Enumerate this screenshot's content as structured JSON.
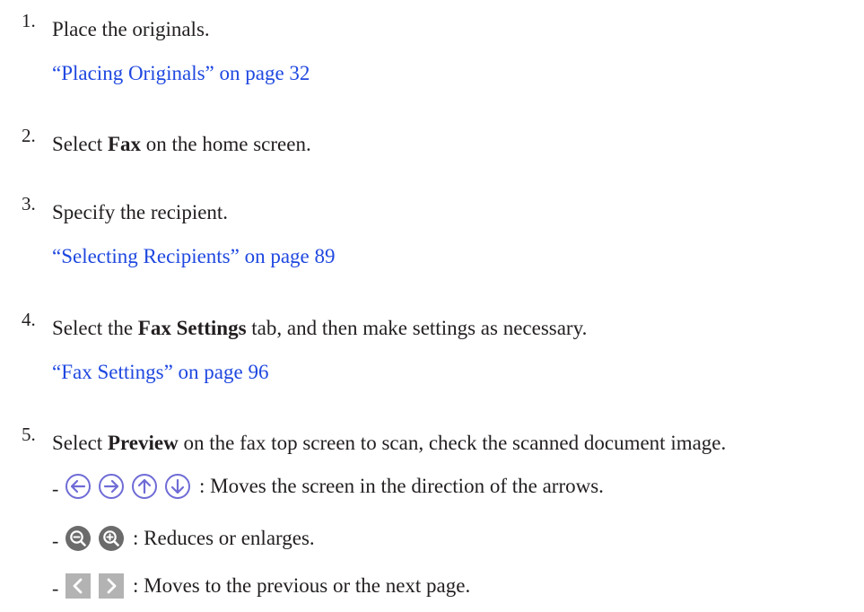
{
  "steps": [
    {
      "number": "1.",
      "text": "Place the originals.",
      "link": "“Placing Originals” on page 32"
    },
    {
      "number": "2.",
      "pre": "Select ",
      "bold": "Fax",
      "post": " on the home screen."
    },
    {
      "number": "3.",
      "text": "Specify the recipient.",
      "link": "“Selecting Recipients” on page 89"
    },
    {
      "number": "4.",
      "pre": "Select the ",
      "bold": "Fax Settings",
      "post": " tab, and then make settings as necessary.",
      "link": "“Fax Settings” on page 96"
    },
    {
      "number": "5.",
      "pre": "Select ",
      "bold": "Preview",
      "post": " on the fax top screen to scan, check the scanned document image."
    }
  ],
  "bullets": [
    {
      "dash": "-",
      "icons": [
        "arrow-left-circle-icon",
        "arrow-right-circle-icon",
        "arrow-up-circle-icon",
        "arrow-down-circle-icon"
      ],
      "description": ": Moves the screen in the direction of the arrows."
    },
    {
      "dash": "-",
      "icons": [
        "zoom-out-icon",
        "zoom-in-icon"
      ],
      "description": ": Reduces or enlarges."
    },
    {
      "dash": "-",
      "icons": [
        "previous-page-icon",
        "next-page-icon"
      ],
      "description": ": Moves to the previous or the next page."
    }
  ],
  "colors": {
    "text": "#231f20",
    "link": "#1f48e0",
    "icon_stroke": "#6f6cd6",
    "zoom_fill": "#6b6b6b",
    "page_button_fill": "#b3b3b3"
  }
}
